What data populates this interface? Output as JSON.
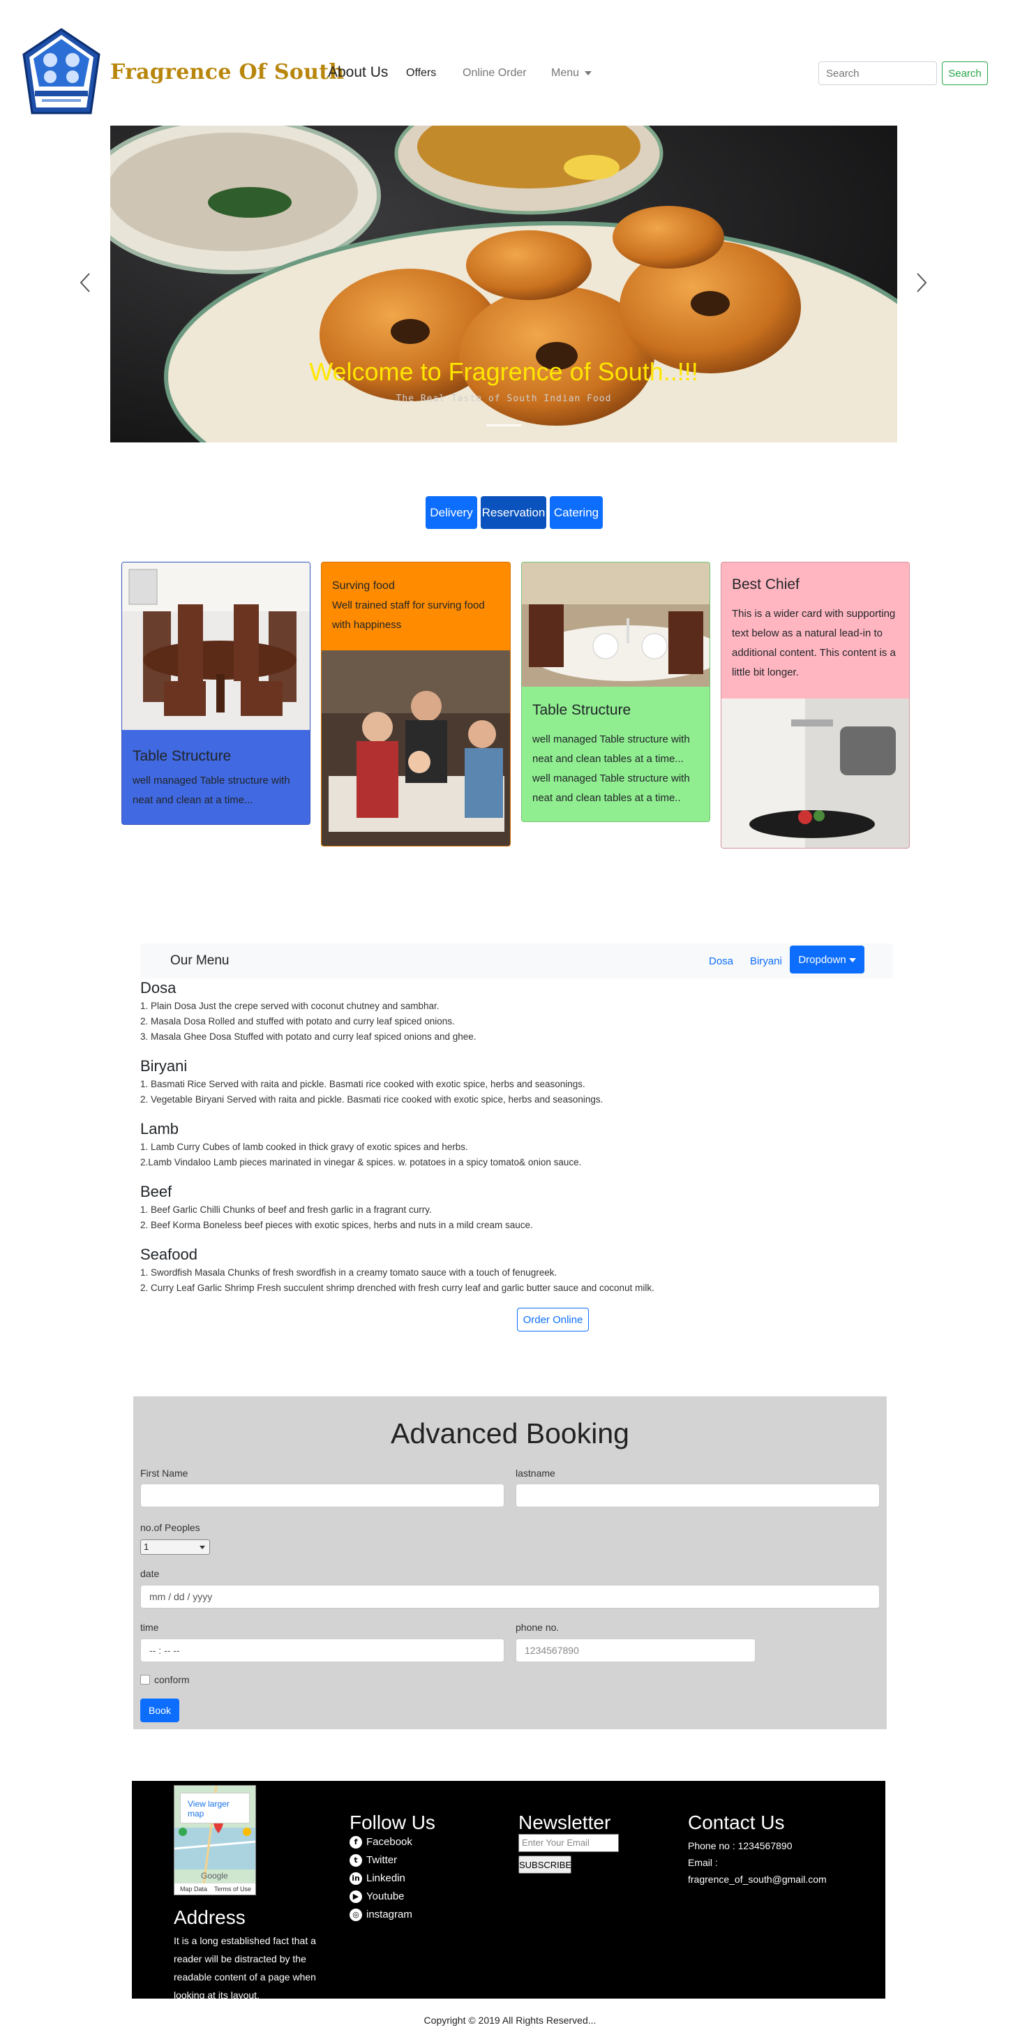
{
  "navbar": {
    "brand": "Fragrence Of South",
    "logo_text": "FRAGRENCE OF SOUTH",
    "about": "About Us",
    "offers": "Offers",
    "online_order": "Online Order",
    "menu": "Menu",
    "search_placeholder": "Search",
    "search_button": "Search"
  },
  "carousel": {
    "title": "Welcome to Fragrence of South..!!!",
    "subtitle": "The Real Taste of South Indian Food",
    "prev_icon": "chevron-left-icon",
    "next_icon": "chevron-right-icon"
  },
  "services": {
    "delivery": "Delivery",
    "reservation": "Reservation",
    "catering": "Catering"
  },
  "cards": [
    {
      "title": "Table Structure",
      "text": "well managed Table structure with neat and clean at a time...",
      "color": "#4169e1"
    },
    {
      "title": "Surving food",
      "text": "Well trained staff for surving food with happiness",
      "color": "#ff8c00"
    },
    {
      "title": "Table Structure",
      "text": "well managed Table structure with neat and clean tables at a time... well managed Table structure with neat and clean tables at a time..",
      "color": "#90ee90"
    },
    {
      "title": "Best Chief",
      "text": "This is a wider card with supporting text below as a natural lead-in to additional content. This content is a little bit longer.",
      "color": "#ffb6c1"
    }
  ],
  "menu": {
    "brand": "Our Menu",
    "links": [
      "Dosa",
      "Biryani"
    ],
    "dropdown": "Dropdown",
    "categories": [
      {
        "title": "Dosa",
        "items": [
          "1. Plain Dosa Just the crepe served with coconut chutney and sambhar.",
          "2. Masala Dosa Rolled and stuffed with potato and curry leaf spiced onions.",
          "3. Masala Ghee Dosa Stuffed with potato and curry leaf spiced onions and ghee."
        ]
      },
      {
        "title": "Biryani",
        "items": [
          "1. Basmati Rice Served with raita and pickle. Basmati rice cooked with exotic spice, herbs and seasonings.",
          "2. Vegetable Biryani Served with raita and pickle. Basmati rice cooked with exotic spice, herbs and seasonings."
        ]
      },
      {
        "title": "Lamb",
        "items": [
          "1. Lamb Curry Cubes of lamb cooked in thick gravy of exotic spices and herbs.",
          "2.Lamb Vindaloo Lamb pieces marinated in vinegar & spices. w. potatoes in a spicy tomato& onion sauce."
        ]
      },
      {
        "title": "Beef",
        "items": [
          "1. Beef Garlic Chilli Chunks of beef and fresh garlic in a fragrant curry.",
          "2. Beef Korma Boneless beef pieces with exotic spices, herbs and nuts in a mild cream sauce."
        ]
      },
      {
        "title": "Seafood",
        "items": [
          "1. Swordfish Masala Chunks of fresh swordfish in a creamy tomato sauce with a touch of fenugreek.",
          "2. Curry Leaf Garlic Shrimp Fresh succulent shrimp drenched with fresh curry leaf and garlic butter sauce and coconut milk."
        ]
      }
    ],
    "order_button": "Order Online"
  },
  "booking": {
    "title": "Advanced Booking",
    "first_name": "First Name",
    "last_name": "lastname",
    "peoples": "no.of Peoples",
    "peoples_value": "1",
    "date": "date",
    "date_placeholder": "mm / dd / yyyy",
    "time": "time",
    "time_placeholder": "-- : --   --",
    "phone": "phone no.",
    "phone_placeholder": "1234567890",
    "conform": "conform",
    "book": "Book"
  },
  "footer": {
    "map_link": "View larger map",
    "map_google": "Google",
    "map_data": "Map Data",
    "map_terms": "Terms of Use",
    "address_title": "Address",
    "address_text": "It is a long established fact that a reader will be distracted by the readable content of a page when looking at its layout.",
    "follow_title": "Follow Us",
    "social": [
      {
        "label": "Facebook",
        "icon": "facebook-icon",
        "glyph": "f"
      },
      {
        "label": "Twitter",
        "icon": "twitter-icon",
        "glyph": "t"
      },
      {
        "label": "Linkedin",
        "icon": "linkedin-icon",
        "glyph": "in"
      },
      {
        "label": "Youtube",
        "icon": "youtube-icon",
        "glyph": "▶"
      },
      {
        "label": "instagram",
        "icon": "instagram-icon",
        "glyph": "◎"
      }
    ],
    "newsletter_title": "Newsletter",
    "newsletter_placeholder": "Enter Your Email",
    "subscribe": "SUBSCRIBE",
    "contact_title": "Contact Us",
    "phone": "Phone no : 1234567890",
    "email_label": "Email :",
    "email": "fragrence_of_south@gmail.com"
  },
  "copyright": "Copyright © 2019 All Rights Reserved..."
}
